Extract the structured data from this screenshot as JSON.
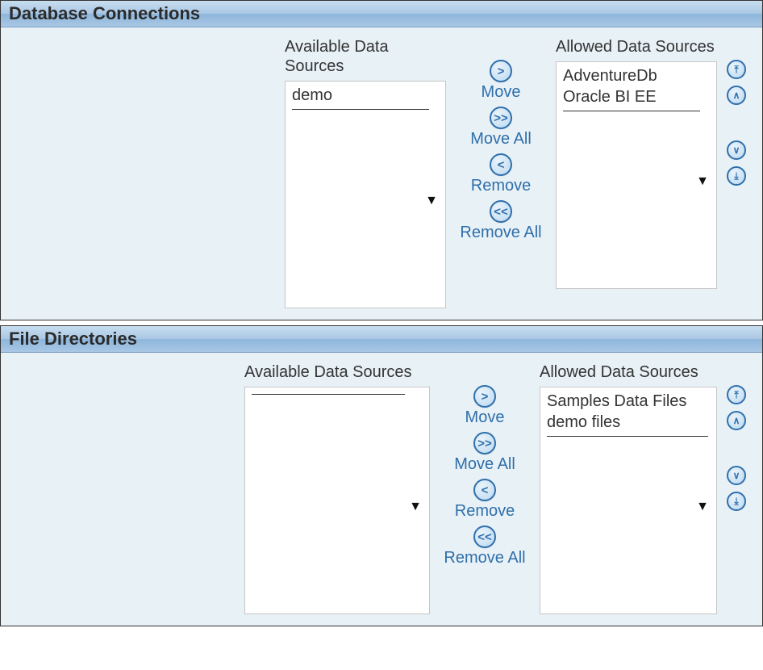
{
  "panels": {
    "db": {
      "title": "Database Connections",
      "available_label": "Available Data Sources",
      "allowed_label": "Allowed Data Sources",
      "available_items": {
        "0": "demo"
      },
      "allowed_items": {
        "0": "AdventureDb",
        "1": "Oracle BI EE"
      }
    },
    "files": {
      "title": "File Directories",
      "available_label": "Available Data Sources",
      "allowed_label": "Allowed Data Sources",
      "available_items": {},
      "allowed_items": {
        "0": "Samples Data Files",
        "1": "demo files"
      }
    }
  },
  "buttons": {
    "move": "Move",
    "move_all": "Move All",
    "remove": "Remove",
    "remove_all": "Remove All"
  },
  "icons": {
    "gt": ">",
    "gtgt": ">>",
    "lt": "<",
    "ltlt": "<<",
    "top": "⤒",
    "up": "∧",
    "down": "∨",
    "bottom": "⤓"
  }
}
